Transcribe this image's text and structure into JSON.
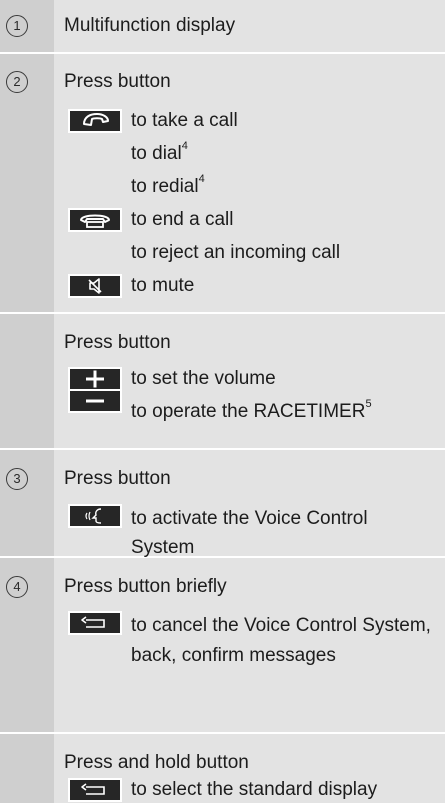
{
  "rows": {
    "r1": {
      "num": "1",
      "text": "Multifunction display"
    },
    "r2": {
      "num": "2",
      "heading": "Press button",
      "take_call": "to take a call",
      "dial": "to dial",
      "dial_sup": "4",
      "redial": "to redial",
      "redial_sup": "4",
      "end_call": "to end a call",
      "reject": "to reject an incoming call",
      "mute": "to mute"
    },
    "r2b": {
      "heading": "Press button",
      "volume": "to set the volume",
      "racetimer": "to operate the RACETIMER",
      "racetimer_sup": "5"
    },
    "r3": {
      "num": "3",
      "heading": "Press button",
      "voice": "to activate the Voice Control System"
    },
    "r4": {
      "num": "4",
      "heading": "Press button briefly",
      "cancel": "to cancel the Voice Control System, back, confirm messages"
    },
    "r4b": {
      "heading": "Press and hold button",
      "standard": "to select the standard display"
    }
  },
  "icons": {
    "phone_pickup": "phone-pickup-icon",
    "phone_hangup": "phone-hangup-icon",
    "mute": "mute-icon",
    "plus": "plus-icon",
    "minus": "minus-icon",
    "voice": "voice-control-icon",
    "back": "back-icon"
  },
  "colors": {
    "background": "#e3e3e3",
    "number_column": "#cfcfcf",
    "key": "#262626"
  }
}
